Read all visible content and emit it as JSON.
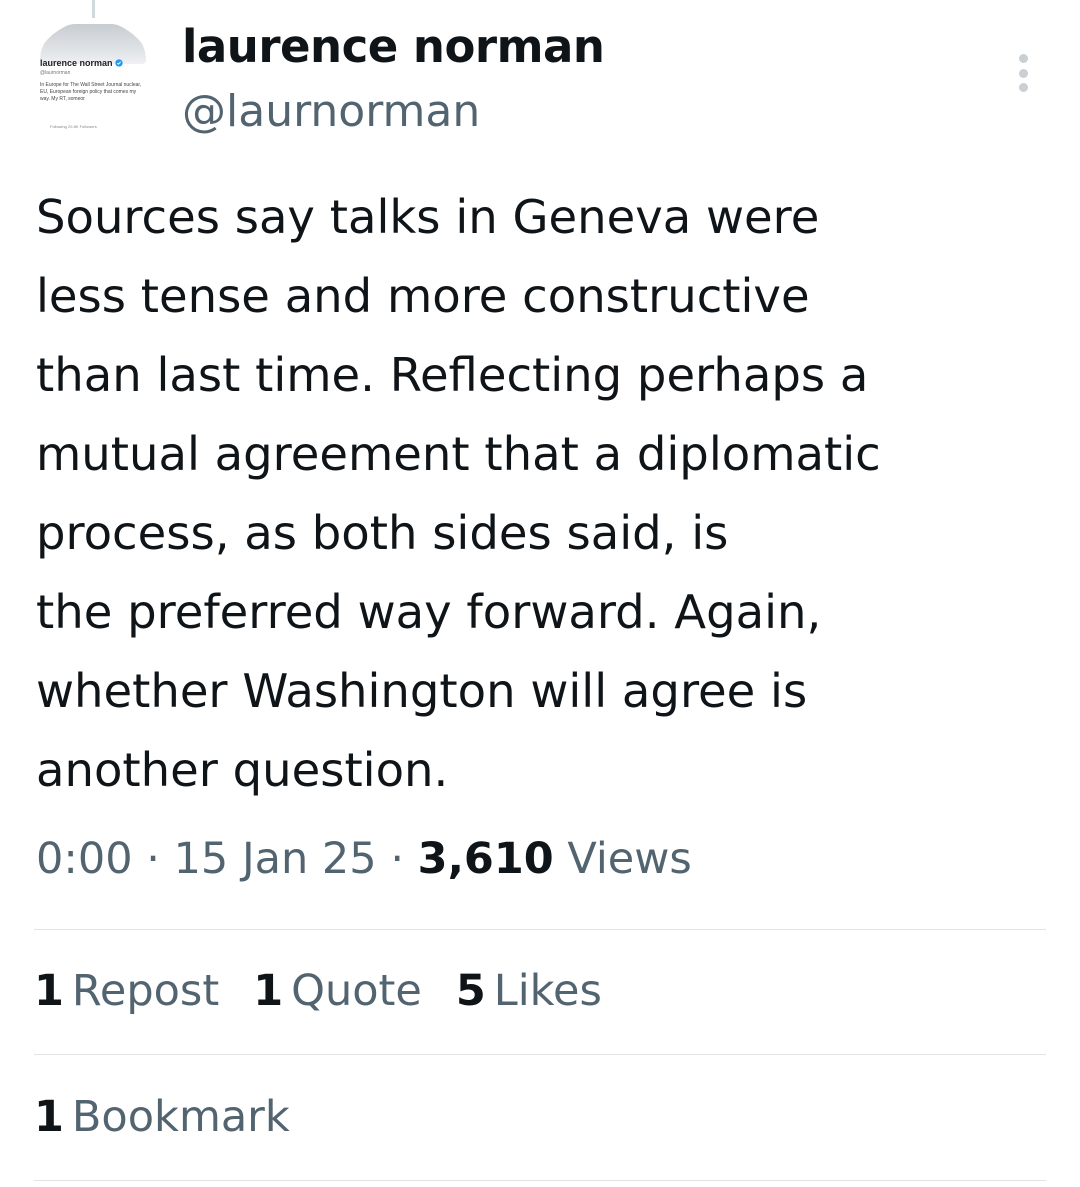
{
  "author": {
    "display_name": "laurence norman",
    "handle": "@laurnorman",
    "avatar_snippet": {
      "name": "laurence norman",
      "handle": "@laurnorman",
      "bio": "In Europe for The Wall Street Journal nuclear, EU, European foreign policy that comes my way. My RT, someor",
      "follow_line": "Following 29.8K Followers"
    }
  },
  "tweet": {
    "text_lines": [
      "Sources say talks in Geneva were",
      "less tense and more constructive",
      "than last time. Reflecting perhaps a",
      "mutual agreement that a diplomatic",
      "process, as both sides said, is",
      "the preferred way forward. Again,",
      "whether Washington will agree is",
      "another question."
    ],
    "time": "0:00",
    "date": "15 Jan 25",
    "separator": "·",
    "views_count": "3,610",
    "views_label": "Views"
  },
  "stats": {
    "reposts": {
      "count": "1",
      "label": "Repost"
    },
    "quotes": {
      "count": "1",
      "label": "Quote"
    },
    "likes": {
      "count": "5",
      "label": "Likes"
    },
    "bookmarks": {
      "count": "1",
      "label": "Bookmark"
    }
  },
  "icons": {
    "more": "more-vertical-icon",
    "verified": "verified-badge-icon"
  },
  "colors": {
    "primary_text": "#0f1419",
    "secondary_text": "#536471",
    "divider": "#dfe3e6",
    "verified": "#1d9bf0"
  }
}
